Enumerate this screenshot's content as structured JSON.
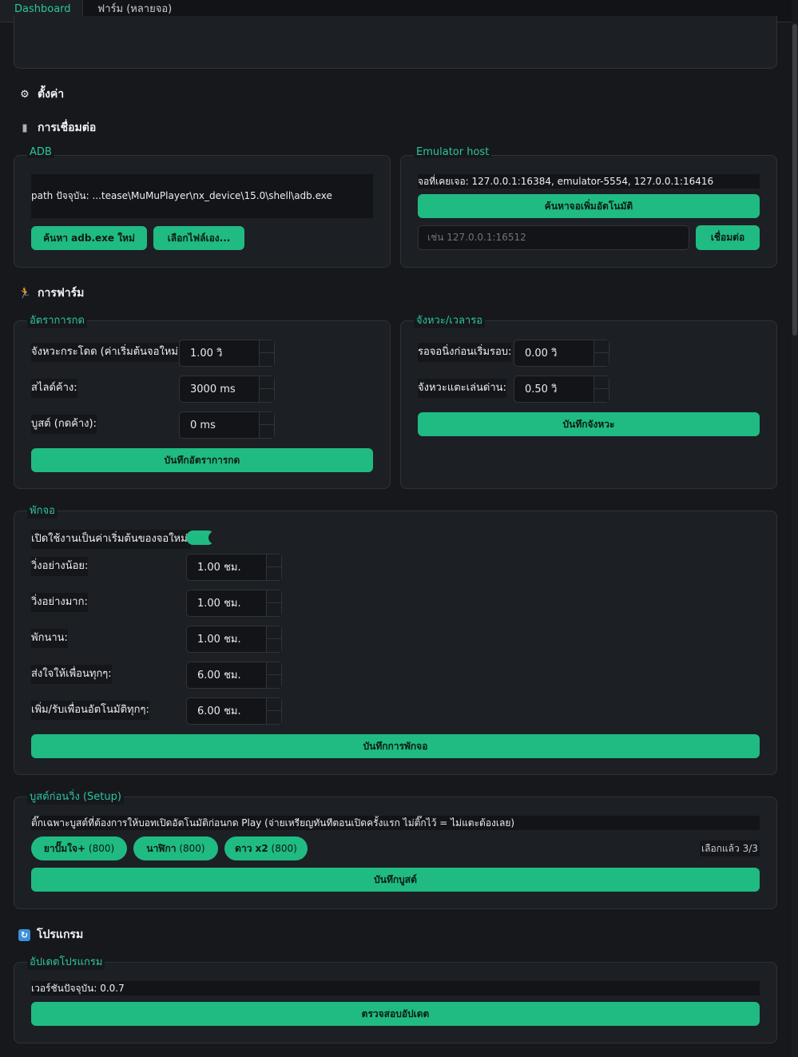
{
  "tabs": {
    "dashboard": "Dashboard",
    "farm_multi": "ฟาร์ม (หลายจอ)"
  },
  "settings": {
    "title": "ตั้งค่า",
    "icon": "gear-icon"
  },
  "connection": {
    "title": "การเชื่อมต่อ",
    "icon": "plug-icon",
    "adb": {
      "legend": "ADB",
      "path_text": "path ปัจจุบัน: ...tease\\MuMuPlayer\\nx_device\\15.0\\shell\\adb.exe",
      "find_button": "ค้นหา adb.exe ใหม่",
      "choose_button": "เลือกไฟล์เอง..."
    },
    "emulator": {
      "legend": "Emulator host",
      "found_text": "จอที่เคยเจอ: 127.0.0.1:16384, emulator-5554, 127.0.0.1:16416",
      "auto_button": "ค้นหาจอเพิ่มอัตโนมัติ",
      "host_placeholder": "เช่น 127.0.0.1:16512",
      "connect_button": "เชื่อมต่อ"
    }
  },
  "farm": {
    "title": "การฟาร์ม",
    "icon": "runner-icon",
    "press_rate": {
      "legend": "อัตราการกด",
      "jump_label": "จังหวะกระโดด (ค่าเริ่มต้นจอใหม่):",
      "jump_value": "1.00 วิ",
      "slide_label": "สไลด์ค้าง:",
      "slide_value": "3000 ms",
      "boost_label": "บูสต์ (กดค้าง):",
      "boost_value": "0 ms",
      "save_button": "บันทึกอัตราการกด"
    },
    "timing": {
      "legend": "จังหวะ/เวลารอ",
      "wait_label": "รอจอนิ่งก่อนเริ่มรอบ:",
      "wait_value": "0.00 วิ",
      "tap_label": "จังหวะแตะเล่นด่าน:",
      "tap_value": "0.50 วิ",
      "save_button": "บันทึกจังหวะ"
    }
  },
  "rest": {
    "legend": "พักจอ",
    "enable_label": "เปิดใช้งานเป็นค่าเริ่มต้นของจอใหม่:",
    "enable_on": true,
    "min_run_label": "วิ่งอย่างน้อย:",
    "min_run_value": "1.00 ชม.",
    "max_run_label": "วิ่งอย่างมาก:",
    "max_run_value": "1.00 ชม.",
    "rest_label": "พักนาน:",
    "rest_value": "1.00 ชม.",
    "hearts_label": "ส่งใจให้เพื่อนทุกๆ:",
    "hearts_value": "6.00 ชม.",
    "friends_label": "เพิ่ม/รับเพื่อนอัตโนมัติทุกๆ:",
    "friends_value": "6.00 ชม.",
    "save_button": "บันทึกการพักจอ"
  },
  "boost": {
    "legend": "บูสต์ก่อนวิ่ง (Setup)",
    "description": "ติ๊กเฉพาะบูสต์ที่ต้องการให้บอทเปิดอัตโนมัติก่อนกด Play (จ่ายเหรียญทันทีตอนเปิดครั้งแรก ไม่ติ๊กไว้ = ไม่แตะต้องเลย)",
    "items": [
      {
        "name": "ยาปั๊มใจ+",
        "cost": "(800)"
      },
      {
        "name": "นาฬิกา",
        "cost": "(800)"
      },
      {
        "name": "ดาว x2",
        "cost": "(800)"
      }
    ],
    "selected_text": "เลือกแล้ว 3/3",
    "save_button": "บันทึกบูสต์"
  },
  "program": {
    "title": "โปรแกรม",
    "icon": "refresh-icon",
    "update": {
      "legend": "อัปเดตโปรแกรม",
      "version_text": "เวอร์ชันปัจจุบัน: 0.0.7",
      "check_button": "ตรวจสอบอัปเดต"
    }
  }
}
